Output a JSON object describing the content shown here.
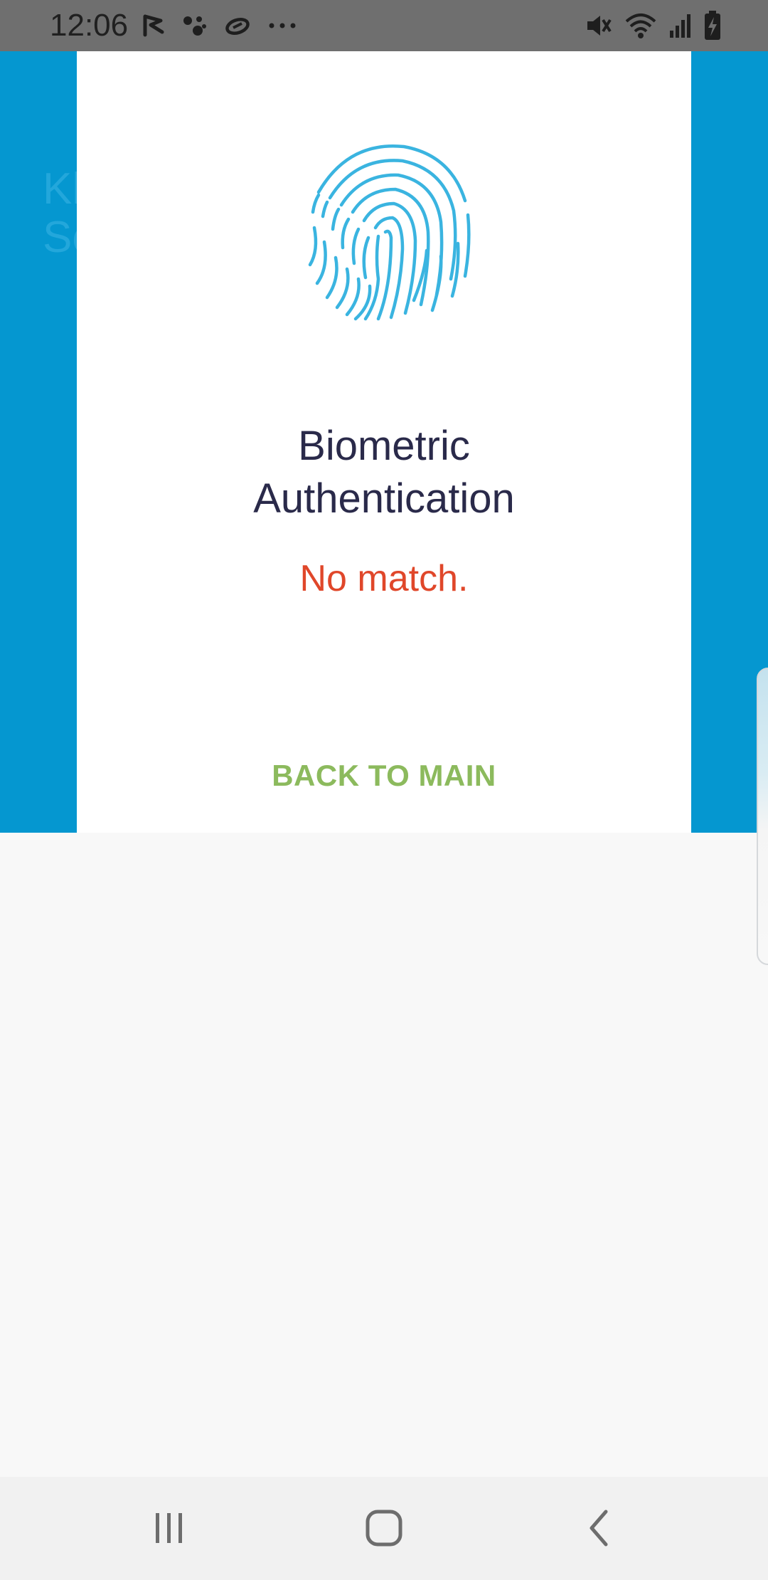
{
  "status_bar": {
    "time": "12:06",
    "left_icons": [
      "check-flag-icon",
      "assistant-dots-icon",
      "sync-loop-icon",
      "more-notifications-icon"
    ],
    "right_icons": [
      "vibrate-mute-icon",
      "wifi-icon",
      "signal-bars-icon",
      "battery-charging-icon"
    ]
  },
  "background_app": {
    "title_partial": "Kl\nSc",
    "accent_color": "#0597d0"
  },
  "dialog": {
    "icon": "fingerprint-icon",
    "title": "Biometric\nAuthentication",
    "status": "No match.",
    "action_label": "BACK TO MAIN",
    "status_color": "#e0472a",
    "action_color": "#8cba5d",
    "icon_color": "#3ab4e0"
  },
  "nav_bar": {
    "buttons": [
      "recent-apps-icon",
      "home-icon",
      "back-icon"
    ]
  }
}
